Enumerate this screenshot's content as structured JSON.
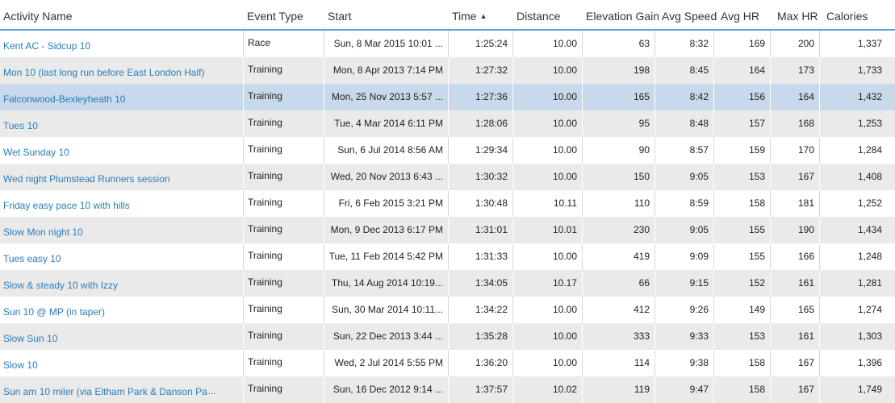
{
  "columns": {
    "name": "Activity Name",
    "type": "Event Type",
    "start": "Start",
    "time": "Time",
    "distance": "Distance",
    "elevation": "Elevation Gain",
    "avg_speed": "Avg Speed",
    "avg_hr": "Avg HR",
    "max_hr": "Max HR",
    "calories": "Calories",
    "sort_icon": "sort-ascending-icon"
  },
  "rows": [
    {
      "name": "Kent AC - Sidcup 10",
      "type": "Race",
      "start": "Sun, 8 Mar 2015 10:01 ...",
      "time": "1:25:24",
      "distance": "10.00",
      "elevation": "63",
      "avg_speed": "8:32",
      "avg_hr": "169",
      "max_hr": "200",
      "calories": "1,337"
    },
    {
      "name": "Mon 10 (last long run before East London Half)",
      "type": "Training",
      "start": "Mon, 8 Apr 2013 7:14 PM",
      "time": "1:27:32",
      "distance": "10.00",
      "elevation": "198",
      "avg_speed": "8:45",
      "avg_hr": "164",
      "max_hr": "173",
      "calories": "1,733"
    },
    {
      "name": "Falconwood-Bexleyheath 10",
      "type": "Training",
      "start": "Mon, 25 Nov 2013 5:57 ...",
      "time": "1:27:36",
      "distance": "10.00",
      "elevation": "165",
      "avg_speed": "8:42",
      "avg_hr": "156",
      "max_hr": "164",
      "calories": "1,432"
    },
    {
      "name": "Tues 10",
      "type": "Training",
      "start": "Tue, 4 Mar 2014 6:11 PM",
      "time": "1:28:06",
      "distance": "10.00",
      "elevation": "95",
      "avg_speed": "8:48",
      "avg_hr": "157",
      "max_hr": "168",
      "calories": "1,253"
    },
    {
      "name": "Wet Sunday 10",
      "type": "Training",
      "start": "Sun, 6 Jul 2014 8:56 AM",
      "time": "1:29:34",
      "distance": "10.00",
      "elevation": "90",
      "avg_speed": "8:57",
      "avg_hr": "159",
      "max_hr": "170",
      "calories": "1,284"
    },
    {
      "name": "Wed night Plumstead Runners session",
      "type": "Training",
      "start": "Wed, 20 Nov 2013 6:43 ...",
      "time": "1:30:32",
      "distance": "10.00",
      "elevation": "150",
      "avg_speed": "9:05",
      "avg_hr": "153",
      "max_hr": "167",
      "calories": "1,408"
    },
    {
      "name": "Friday easy pace 10 with hills",
      "type": "Training",
      "start": "Fri, 6 Feb 2015 3:21 PM",
      "time": "1:30:48",
      "distance": "10.11",
      "elevation": "110",
      "avg_speed": "8:59",
      "avg_hr": "158",
      "max_hr": "181",
      "calories": "1,252"
    },
    {
      "name": "Slow Mon night 10",
      "type": "Training",
      "start": "Mon, 9 Dec 2013 6:17 PM",
      "time": "1:31:01",
      "distance": "10.01",
      "elevation": "230",
      "avg_speed": "9:05",
      "avg_hr": "155",
      "max_hr": "190",
      "calories": "1,434"
    },
    {
      "name": "Tues easy 10",
      "type": "Training",
      "start": "Tue, 11 Feb 2014 5:42 PM",
      "time": "1:31:33",
      "distance": "10.00",
      "elevation": "419",
      "avg_speed": "9:09",
      "avg_hr": "155",
      "max_hr": "166",
      "calories": "1,248"
    },
    {
      "name": "Slow & steady 10 with Izzy",
      "type": "Training",
      "start": "Thu, 14 Aug 2014 10:19...",
      "time": "1:34:05",
      "distance": "10.17",
      "elevation": "66",
      "avg_speed": "9:15",
      "avg_hr": "152",
      "max_hr": "161",
      "calories": "1,281"
    },
    {
      "name": "Sun 10 @ MP (in taper)",
      "type": "Training",
      "start": "Sun, 30 Mar 2014 10:11...",
      "time": "1:34:22",
      "distance": "10.00",
      "elevation": "412",
      "avg_speed": "9:26",
      "avg_hr": "149",
      "max_hr": "165",
      "calories": "1,274"
    },
    {
      "name": "Slow Sun 10",
      "type": "Training",
      "start": "Sun, 22 Dec 2013 3:44 ...",
      "time": "1:35:28",
      "distance": "10.00",
      "elevation": "333",
      "avg_speed": "9:33",
      "avg_hr": "153",
      "max_hr": "161",
      "calories": "1,303"
    },
    {
      "name": "Slow 10",
      "type": "Training",
      "start": "Wed, 2 Jul 2014 5:55 PM",
      "time": "1:36:20",
      "distance": "10.00",
      "elevation": "114",
      "avg_speed": "9:38",
      "avg_hr": "158",
      "max_hr": "167",
      "calories": "1,396"
    },
    {
      "name": "Sun am 10 miler (via Eltham Park & Danson Pa",
      "type": "Training",
      "start": "Sun, 16 Dec 2012 9:14 ...",
      "time": "1:37:57",
      "distance": "10.02",
      "elevation": "119",
      "avg_speed": "9:47",
      "avg_hr": "158",
      "max_hr": "167",
      "calories": "1,749"
    }
  ],
  "selected_row_index": 2,
  "truncation_marker": "...",
  "colors": {
    "link": "#2a7db8",
    "header_border": "#5aa7d6",
    "row_alt": "#ebeaea",
    "row_selected": "#c8d9eb"
  }
}
